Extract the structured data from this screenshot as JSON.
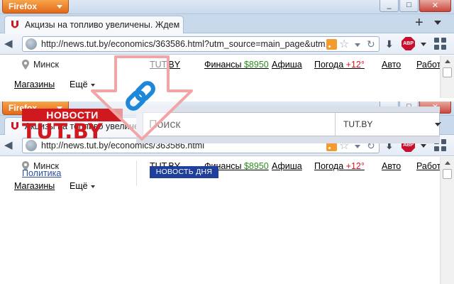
{
  "browser": {
    "menu_label": "Firefox",
    "window_controls": {
      "minimize": "–",
      "maximize": "□",
      "close": "✕"
    },
    "new_tab_symbol": "+"
  },
  "top_window": {
    "tab_title": "Акцизы на топливо увеличены. Ждем ...",
    "url": "http://news.tut.by/economics/363586.html?utm_source=main_page&utm..."
  },
  "bottom_window": {
    "tab_title": "Акцизы на топливо увеличены. Ждем ...",
    "url": "http://news.tut.by/economics/363586.html"
  },
  "site_nav": {
    "city": "Минск",
    "links": [
      {
        "label": "TUT.BY"
      },
      {
        "label": "Финансы",
        "extra": "$8950"
      },
      {
        "label": "Афиша"
      },
      {
        "label": "Погода",
        "extra": "+12°"
      },
      {
        "label": "Авто"
      },
      {
        "label": "Работ"
      }
    ],
    "shops": "Магазины",
    "more": "Ещё"
  },
  "logo": {
    "top": "НОВОСТИ",
    "bottom": "TUT.BY"
  },
  "search": {
    "placeholder": "Поиск",
    "scope": "TUT.BY"
  },
  "sidebar": {
    "first_category": "Политика"
  },
  "badge": {
    "news_of_day": "НОВОСТЬ ДНЯ"
  },
  "toolbar": {
    "abp": "ABP"
  },
  "colors": {
    "brand_red": "#d0191f",
    "badge_blue": "#1f3f9a",
    "price_green": "#2e8b1d",
    "temp_red": "#d9121e",
    "firefox_orange": "#e3681a",
    "link_icon_blue": "#1e88d8"
  },
  "icons": {
    "favicon": "tut-by-favicon",
    "overlay": "chain-link-icon",
    "arrow": "down-arrow"
  }
}
